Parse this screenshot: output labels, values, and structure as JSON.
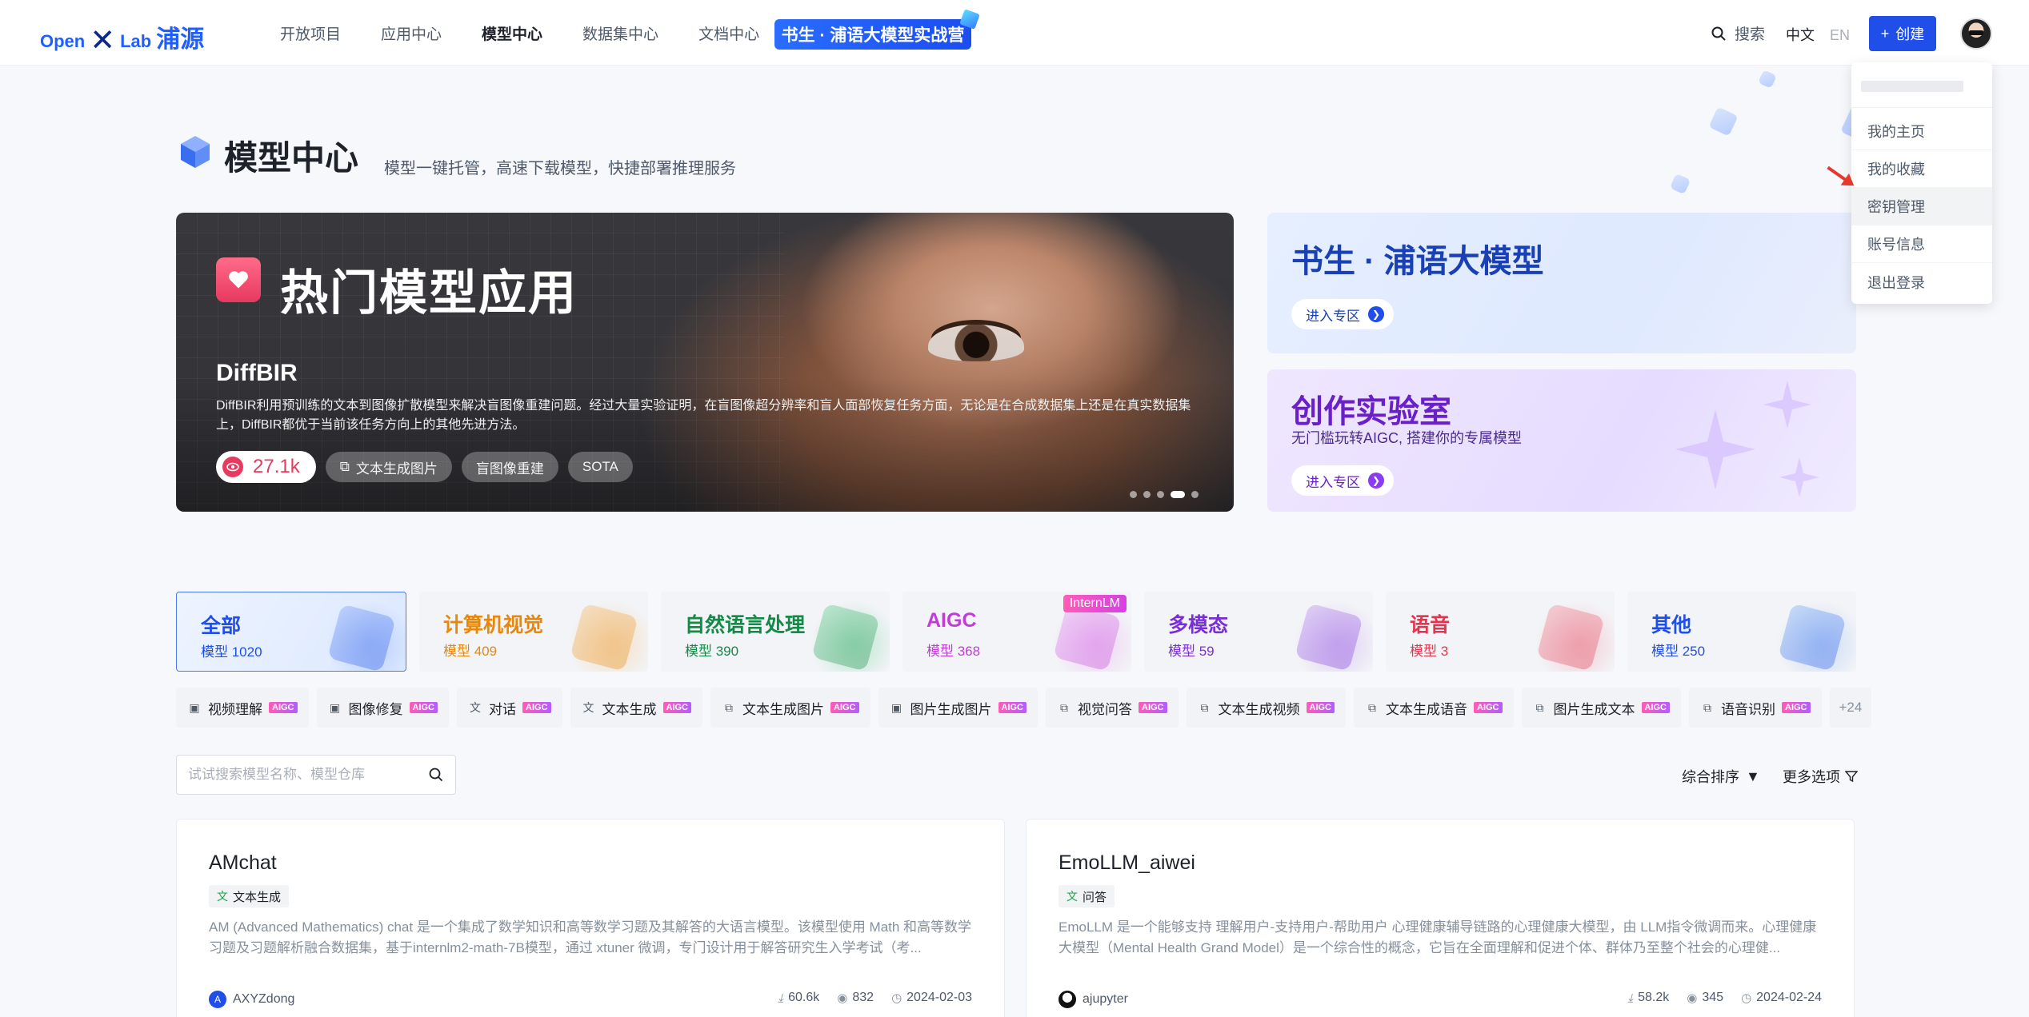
{
  "header": {
    "logo": {
      "part1": "Open",
      "part2": "Lab",
      "part3": "浦源"
    },
    "nav": [
      "开放项目",
      "应用中心",
      "模型中心",
      "数据集中心",
      "文档中心"
    ],
    "active_nav_index": 2,
    "camp_banner": "书生 · 浦语大模型实战营",
    "search_label": "搜索",
    "lang_zh": "中文",
    "lang_en": "EN",
    "create_label": "创建"
  },
  "user_menu": {
    "items": [
      "我的主页",
      "我的收藏",
      "密钥管理",
      "账号信息",
      "退出登录"
    ],
    "hovered_index": 2
  },
  "page": {
    "title": "模型中心",
    "subtitle": "模型一键托管，高速下载模型，快捷部署推理服务"
  },
  "hero": {
    "heading": "热门模型应用",
    "model_name": "DiffBIR",
    "description": "DiffBIR利用预训练的文本到图像扩散模型来解决盲图像重建问题。经过大量实验证明，在盲图像超分辨率和盲人面部恢复任务方面，无论是在合成数据集上还是在真实数据集上，DiffBIR都优于当前该任务方向上的其他先进方法。",
    "views": "27.1k",
    "tags": [
      "文本生成图片",
      "盲图像重建",
      "SOTA"
    ],
    "dot_count": 5,
    "active_dot": 3
  },
  "promos": [
    {
      "title": "书生 · 浦语大模型",
      "subtitle": "",
      "button": "进入专区"
    },
    {
      "title": "创作实验室",
      "subtitle": "无门槛玩转AIGC, 搭建你的专属模型",
      "button": "进入专区"
    }
  ],
  "categories": [
    {
      "name": "全部",
      "count_label": "模型 1020",
      "color": "#1f4fe8",
      "accent": "#6e98f5"
    },
    {
      "name": "计算机视觉",
      "count_label": "模型 409",
      "color": "#e8870a",
      "accent": "#f7b35a"
    },
    {
      "name": "自然语言处理",
      "count_label": "模型 390",
      "color": "#138a45",
      "accent": "#4cc77f"
    },
    {
      "name": "AIGC",
      "count_label": "模型 368",
      "color": "#c23bd8",
      "accent": "#e58bf2",
      "badge": "InternLM"
    },
    {
      "name": "多模态",
      "count_label": "模型 59",
      "color": "#7a2fd6",
      "accent": "#b383f0"
    },
    {
      "name": "语音",
      "count_label": "模型 3",
      "color": "#e0364f",
      "accent": "#f17d8d"
    },
    {
      "name": "其他",
      "count_label": "模型 250",
      "color": "#1f4fe8",
      "accent": "#6ea7f5"
    }
  ],
  "tags": [
    {
      "label": "视频理解",
      "icon": "image-icon",
      "glyph": "▣"
    },
    {
      "label": "图像修复",
      "icon": "image-icon",
      "glyph": "▣"
    },
    {
      "label": "对话",
      "icon": "translate-icon",
      "glyph": "文"
    },
    {
      "label": "文本生成",
      "icon": "translate-icon",
      "glyph": "文"
    },
    {
      "label": "文本生成图片",
      "icon": "link-icon",
      "glyph": "⧉"
    },
    {
      "label": "图片生成图片",
      "icon": "image-icon",
      "glyph": "▣"
    },
    {
      "label": "视觉问答",
      "icon": "link-icon",
      "glyph": "⧉"
    },
    {
      "label": "文本生成视频",
      "icon": "link-icon",
      "glyph": "⧉"
    },
    {
      "label": "文本生成语音",
      "icon": "link-icon",
      "glyph": "⧉"
    },
    {
      "label": "图片生成文本",
      "icon": "link-icon",
      "glyph": "⧉"
    },
    {
      "label": "语音识别",
      "icon": "link-icon",
      "glyph": "⧉"
    }
  ],
  "aigc_badge": "AIGC",
  "more_tags": "+24",
  "search": {
    "placeholder": "试试搜索模型名称、模型仓库"
  },
  "sort_label": "综合排序",
  "more_options_label": "更多选项",
  "models": [
    {
      "title": "AMchat",
      "tag": "文本生成",
      "description": "AM (Advanced Mathematics) chat 是一个集成了数学知识和高等数学习题及其解答的大语言模型。该模型使用 Math 和高等数学习题及习题解析融合数据集，基于internlm2-math-7B模型，通过 xtuner 微调，专门设计用于解答研究生入学考试（考...",
      "author": "AXYZdong",
      "author_initial": "A",
      "downloads": "60.6k",
      "views": "832",
      "date": "2024-02-03"
    },
    {
      "title": "EmoLLM_aiwei",
      "tag": "问答",
      "description": "EmoLLM 是一个能够支持 理解用户-支持用户-帮助用户 心理健康辅导链路的心理健康大模型，由 LLM指令微调而来。心理健康大模型（Mental Health Grand Model）是一个综合性的概念，它旨在全面理解和促进个体、群体乃至整个社会的心理健...",
      "author": "ajupyter",
      "author_initial": "",
      "downloads": "58.2k",
      "views": "345",
      "date": "2024-02-24"
    }
  ]
}
